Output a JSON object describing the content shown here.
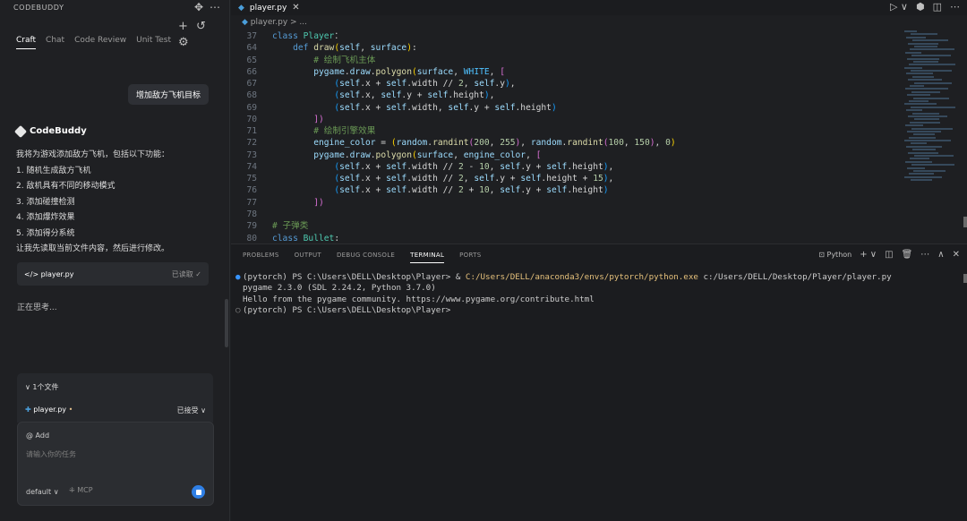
{
  "left": {
    "title": "CODEBUDDY",
    "top_icons": [
      "✥",
      "⋯"
    ],
    "tabs": [
      "Craft",
      "Chat",
      "Code Review",
      "Unit Test"
    ],
    "tab_icons": [
      "+",
      "↺",
      "⚙"
    ],
    "user_message": "增加敌方飞机目标",
    "assistant_name": "CodeBuddy",
    "response_lines": [
      "我将为游戏添加敌方飞机，包括以下功能：",
      "1. 随机生成敌方飞机",
      "2. 敌机具有不同的移动模式",
      "3. 添加碰撞检测",
      "4. 添加爆炸效果",
      "5. 添加得分系统",
      "让我先读取当前文件内容，然后进行修改。"
    ],
    "file_card": {
      "icon": "</>",
      "name": "player.py",
      "status": "已读取 ✓"
    },
    "thinking": "正在思考...",
    "files_panel": {
      "header": "∨ 1个文件",
      "file": "player.py",
      "status": "已接受 ∨"
    },
    "input": {
      "add_chip": "@ Add",
      "placeholder": "请输入你的任务",
      "mode": "default ∨",
      "mcp": "⁜ MCP"
    }
  },
  "editor": {
    "tab_label": "player.py",
    "breadcrumb": "player.py > ...",
    "actions": [
      "▷ ∨",
      "⬢",
      "◫",
      "⋯"
    ],
    "lines": [
      {
        "n": "37",
        "c": [
          [
            "kwb",
            "class "
          ],
          [
            "cls",
            "Player"
          ],
          [
            "",
            "："
          ]
        ]
      },
      {
        "n": "64",
        "c": [
          [
            "",
            "    "
          ],
          [
            "kwb",
            "def "
          ],
          [
            "fnn",
            "draw"
          ],
          [
            "yb",
            "("
          ],
          [
            "sf",
            "self"
          ],
          [
            "",
            ", "
          ],
          [
            "sf",
            "surface"
          ],
          [
            "yb",
            ")"
          ],
          [
            "",
            ":"
          ]
        ]
      },
      {
        "n": "65",
        "c": [
          [
            "",
            "        "
          ],
          [
            "cmt",
            "# 绘制飞机主体"
          ]
        ]
      },
      {
        "n": "66",
        "c": [
          [
            "",
            "        "
          ],
          [
            "sf",
            "pygame"
          ],
          [
            "",
            "."
          ],
          [
            "sf",
            "draw"
          ],
          [
            "",
            "."
          ],
          [
            "fnn",
            "polygon"
          ],
          [
            "yb",
            "("
          ],
          [
            "sf",
            "surface"
          ],
          [
            "",
            ", "
          ],
          [
            "const",
            "WHITE"
          ],
          [
            "",
            ", "
          ],
          [
            "pb",
            "["
          ]
        ]
      },
      {
        "n": "67",
        "c": [
          [
            "",
            "            "
          ],
          [
            "bb",
            "("
          ],
          [
            "sf",
            "self"
          ],
          [
            "",
            ".x + "
          ],
          [
            "sf",
            "self"
          ],
          [
            "",
            ".width // "
          ],
          [
            "num",
            "2"
          ],
          [
            "",
            ", "
          ],
          [
            "sf",
            "self"
          ],
          [
            "",
            ".y"
          ],
          [
            "bb",
            ")"
          ],
          [
            "",
            ","
          ]
        ]
      },
      {
        "n": "68",
        "c": [
          [
            "",
            "            "
          ],
          [
            "bb",
            "("
          ],
          [
            "sf",
            "self"
          ],
          [
            "",
            ".x, "
          ],
          [
            "sf",
            "self"
          ],
          [
            "",
            ".y + "
          ],
          [
            "sf",
            "self"
          ],
          [
            "",
            ".height"
          ],
          [
            "bb",
            ")"
          ],
          [
            "",
            ","
          ]
        ]
      },
      {
        "n": "69",
        "c": [
          [
            "",
            "            "
          ],
          [
            "bb",
            "("
          ],
          [
            "sf",
            "self"
          ],
          [
            "",
            ".x + "
          ],
          [
            "sf",
            "self"
          ],
          [
            "",
            ".width, "
          ],
          [
            "sf",
            "self"
          ],
          [
            "",
            ".y + "
          ],
          [
            "sf",
            "self"
          ],
          [
            "",
            ".height"
          ],
          [
            "bb",
            ")"
          ]
        ]
      },
      {
        "n": "70",
        "c": [
          [
            "",
            "        "
          ],
          [
            "pb",
            "])"
          ]
        ]
      },
      {
        "n": "71",
        "c": [
          [
            "",
            "        "
          ],
          [
            "cmt",
            "# 绘制引擎效果"
          ]
        ]
      },
      {
        "n": "72",
        "c": [
          [
            "",
            "        "
          ],
          [
            "sf",
            "engine_color"
          ],
          [
            "",
            " = "
          ],
          [
            "yb",
            "("
          ],
          [
            "sf",
            "random"
          ],
          [
            "",
            "."
          ],
          [
            "fnn",
            "randint"
          ],
          [
            "pb",
            "("
          ],
          [
            "num",
            "200"
          ],
          [
            "",
            ", "
          ],
          [
            "num",
            "255"
          ],
          [
            "pb",
            ")"
          ],
          [
            "",
            ", "
          ],
          [
            "sf",
            "random"
          ],
          [
            "",
            "."
          ],
          [
            "fnn",
            "randint"
          ],
          [
            "pb",
            "("
          ],
          [
            "num",
            "100"
          ],
          [
            "",
            ", "
          ],
          [
            "num",
            "150"
          ],
          [
            "pb",
            ")"
          ],
          [
            "",
            ", "
          ],
          [
            "num",
            "0"
          ],
          [
            "yb",
            ")"
          ]
        ]
      },
      {
        "n": "73",
        "c": [
          [
            "",
            "        "
          ],
          [
            "sf",
            "pygame"
          ],
          [
            "",
            "."
          ],
          [
            "sf",
            "draw"
          ],
          [
            "",
            "."
          ],
          [
            "fnn",
            "polygon"
          ],
          [
            "yb",
            "("
          ],
          [
            "sf",
            "surface"
          ],
          [
            "",
            ", "
          ],
          [
            "sf",
            "engine_color"
          ],
          [
            "",
            ", "
          ],
          [
            "pb",
            "["
          ]
        ]
      },
      {
        "n": "74",
        "c": [
          [
            "",
            "            "
          ],
          [
            "bb",
            "("
          ],
          [
            "sf",
            "self"
          ],
          [
            "",
            ".x + "
          ],
          [
            "sf",
            "self"
          ],
          [
            "",
            ".width // "
          ],
          [
            "num",
            "2"
          ],
          [
            "",
            " - "
          ],
          [
            "num",
            "10"
          ],
          [
            "",
            ", "
          ],
          [
            "sf",
            "self"
          ],
          [
            "",
            ".y + "
          ],
          [
            "sf",
            "self"
          ],
          [
            "",
            ".height"
          ],
          [
            "bb",
            ")"
          ],
          [
            "",
            ","
          ]
        ]
      },
      {
        "n": "75",
        "c": [
          [
            "",
            "            "
          ],
          [
            "bb",
            "("
          ],
          [
            "sf",
            "self"
          ],
          [
            "",
            ".x + "
          ],
          [
            "sf",
            "self"
          ],
          [
            "",
            ".width // "
          ],
          [
            "num",
            "2"
          ],
          [
            "",
            ", "
          ],
          [
            "sf",
            "self"
          ],
          [
            "",
            ".y + "
          ],
          [
            "sf",
            "self"
          ],
          [
            "",
            ".height + "
          ],
          [
            "num",
            "15"
          ],
          [
            "bb",
            ")"
          ],
          [
            "",
            ","
          ]
        ]
      },
      {
        "n": "76",
        "c": [
          [
            "",
            "            "
          ],
          [
            "bb",
            "("
          ],
          [
            "sf",
            "self"
          ],
          [
            "",
            ".x + "
          ],
          [
            "sf",
            "self"
          ],
          [
            "",
            ".width // "
          ],
          [
            "num",
            "2"
          ],
          [
            "",
            " + "
          ],
          [
            "num",
            "10"
          ],
          [
            "",
            ", "
          ],
          [
            "sf",
            "self"
          ],
          [
            "",
            ".y + "
          ],
          [
            "sf",
            "self"
          ],
          [
            "",
            ".height"
          ],
          [
            "bb",
            ")"
          ]
        ]
      },
      {
        "n": "77",
        "c": [
          [
            "",
            "        "
          ],
          [
            "pb",
            "])"
          ]
        ]
      },
      {
        "n": "78",
        "c": [
          [
            "",
            ""
          ]
        ]
      },
      {
        "n": "79",
        "c": [
          [
            "cmt",
            "# 子弹类"
          ]
        ]
      },
      {
        "n": "80",
        "c": [
          [
            "kwb",
            "class "
          ],
          [
            "cls",
            "Bullet"
          ],
          [
            "",
            ":"
          ]
        ]
      }
    ]
  },
  "panel": {
    "tabs": [
      "PROBLEMS",
      "OUTPUT",
      "DEBUG CONSOLE",
      "TERMINAL",
      "PORTS"
    ],
    "active_tab": "TERMINAL",
    "actions": [
      "⊡ Python",
      "+ ∨",
      "◫",
      "🗑",
      "⋯",
      "∧",
      "✕"
    ],
    "terminal": [
      {
        "bullet": "●",
        "kind": "blue",
        "parts": [
          [
            "",
            "(pytorch) PS C:\\Users\\DELL\\Desktop\\Player> & "
          ],
          [
            "tyel",
            "C:/Users/DELL/anaconda3/envs/pytorch/python.exe"
          ],
          [
            "",
            " c:/Users/DELL/Desktop/Player/player.py"
          ]
        ]
      },
      {
        "bullet": "",
        "kind": "",
        "parts": [
          [
            "",
            "pygame 2.3.0 (SDL 2.24.2, Python 3.7.0)"
          ]
        ]
      },
      {
        "bullet": "",
        "kind": "",
        "parts": [
          [
            "",
            "Hello from the pygame community. https://www.pygame.org/contribute.html"
          ]
        ]
      },
      {
        "bullet": "○",
        "kind": "grey",
        "parts": [
          [
            "",
            "(pytorch) PS C:\\Users\\DELL\\Desktop\\Player>"
          ]
        ]
      }
    ]
  },
  "colors": {
    "accent": "#2f7fe5",
    "python": "#4a9eda",
    "keyword": "#569cd6",
    "comment": "#6a9955"
  }
}
